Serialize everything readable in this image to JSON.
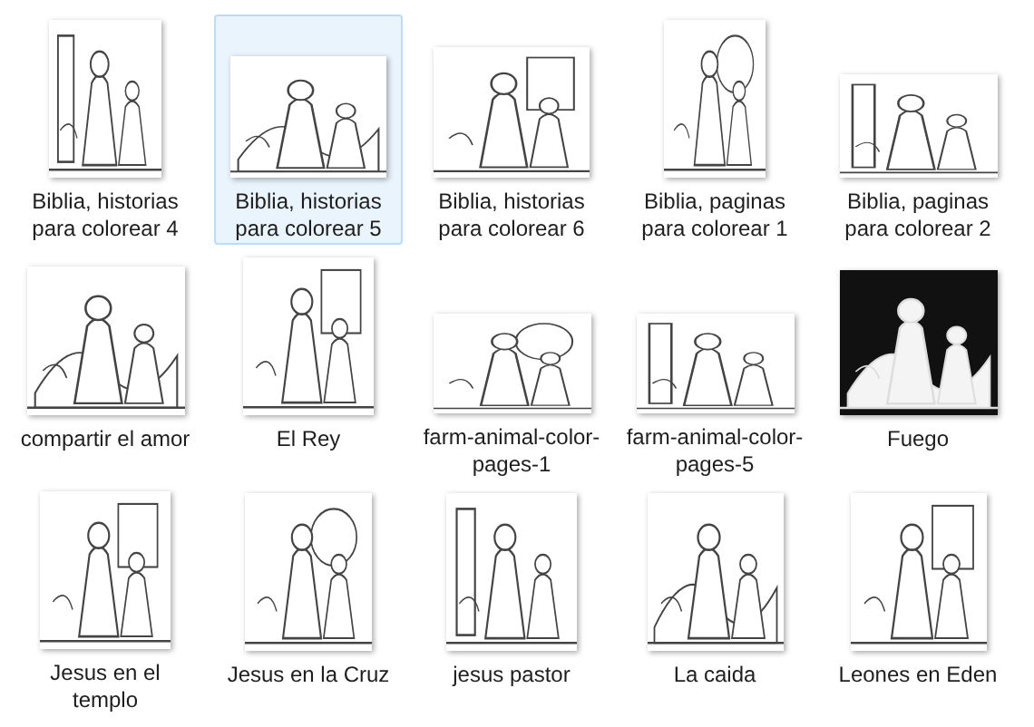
{
  "files": [
    {
      "label": "Biblia, historias para colorear 4",
      "selected": false
    },
    {
      "label": "Biblia, historias para colorear 5",
      "selected": true
    },
    {
      "label": "Biblia, historias para colorear 6",
      "selected": false
    },
    {
      "label": "Biblia, paginas para colorear 1",
      "selected": false
    },
    {
      "label": "Biblia, paginas para colorear 2",
      "selected": false
    },
    {
      "label": "compartir el amor",
      "selected": false
    },
    {
      "label": "El Rey",
      "selected": false
    },
    {
      "label": "farm-animal-color-pages-1",
      "selected": false
    },
    {
      "label": "farm-animal-color-pages-5",
      "selected": false
    },
    {
      "label": "Fuego",
      "selected": false
    },
    {
      "label": "Jesus en el templo",
      "selected": false
    },
    {
      "label": "Jesus en la Cruz",
      "selected": false
    },
    {
      "label": "jesus pastor",
      "selected": false
    },
    {
      "label": "La caida",
      "selected": false
    },
    {
      "label": "Leones en Eden",
      "selected": false
    }
  ]
}
